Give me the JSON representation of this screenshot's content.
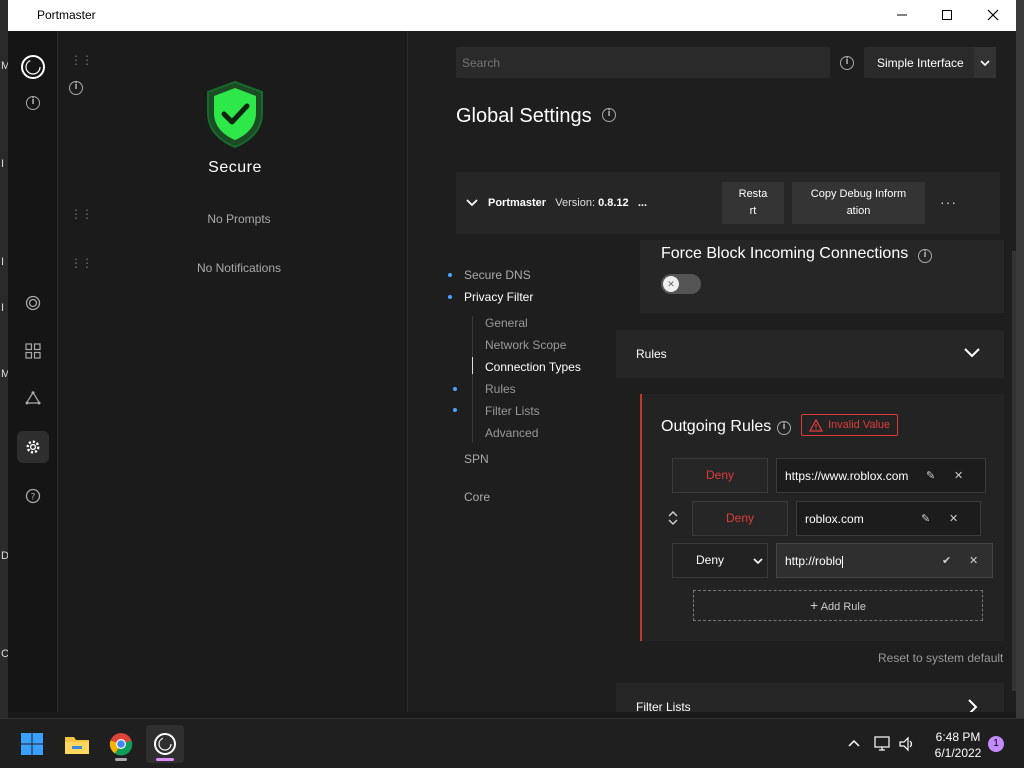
{
  "window": {
    "title": "Portmaster"
  },
  "desktop": {
    "left_chars": [
      "M",
      "I",
      "I",
      "I",
      "M",
      "D",
      "C"
    ]
  },
  "status": {
    "state": "Secure",
    "prompts": "No Prompts",
    "notifications": "No Notifications"
  },
  "header": {
    "search_placeholder": "Search",
    "interface_mode": "Simple Interface"
  },
  "page": {
    "title": "Global Settings"
  },
  "version_bar": {
    "app_name": "Portmaster",
    "version_label": "Version:",
    "version": "0.8.12",
    "ellipsis": "...",
    "restart_line1": "Resta",
    "restart_line2": "rt",
    "debug_line1": "Copy Debug Inform",
    "debug_line2": "ation"
  },
  "toc": {
    "secure_dns": "Secure DNS",
    "privacy_filter": "Privacy Filter",
    "general": "General",
    "network_scope": "Network Scope",
    "connection_types": "Connection Types",
    "rules": "Rules",
    "filter_lists": "Filter Lists",
    "advanced": "Advanced",
    "spn": "SPN",
    "core": "Core"
  },
  "settings": {
    "force_block_title": "Force Block Incoming Connections",
    "force_block_enabled": false,
    "rules_section": "Rules",
    "outgoing_rules_title": "Outgoing Rules",
    "invalid_badge": "Invalid Value",
    "rules": [
      {
        "action": "Deny",
        "value": "https://www.roblox.com"
      },
      {
        "action": "Deny",
        "value": "roblox.com"
      },
      {
        "action": "Deny",
        "value": "http://roblo"
      }
    ],
    "add_rule": "Add Rule",
    "reset": "Reset to system default",
    "filter_lists_section": "Filter Lists"
  },
  "taskbar": {
    "time": "6:48 PM",
    "date": "6/1/2022",
    "notification_count": "1"
  },
  "colors": {
    "accent_blue": "#4aa3ff",
    "error_red": "#e03b3b",
    "secure_green": "#2ee84a"
  }
}
